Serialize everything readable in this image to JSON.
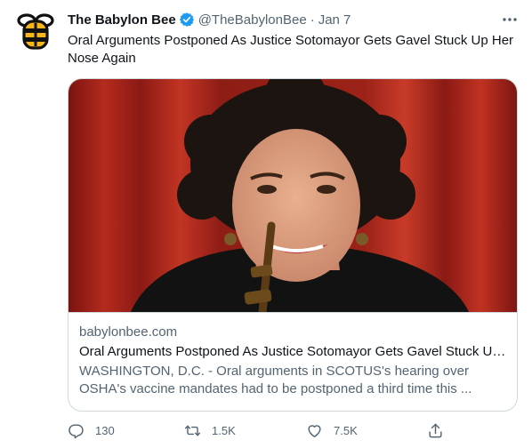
{
  "tweet": {
    "display_name": "The Babylon Bee",
    "handle": "@TheBabylonBee",
    "separator": "·",
    "time": "Jan 7",
    "text": "Oral Arguments Postponed As Justice Sotomayor Gets Gavel Stuck Up Her Nose Again",
    "avatar_icon": "babylon-bee-logo",
    "verified_color": "#1d9bf0"
  },
  "card": {
    "domain": "babylonbee.com",
    "title": "Oral Arguments Postponed As Justice Sotomayor Gets Gavel Stuck Up Her Nose Again",
    "description": "WASHINGTON, D.C. - Oral arguments in SCOTUS's hearing over OSHA's vaccine mandates had to be postponed a third time this ...",
    "image_subject": "photo-of-justice-with-gavel"
  },
  "actions": {
    "reply_count": "130",
    "retweet_count": "1.5K",
    "like_count": "7.5K"
  },
  "colors": {
    "text_primary": "#0f1419",
    "text_secondary": "#536471",
    "border": "#cfd9de",
    "logo_yellow": "#f5b51b"
  }
}
